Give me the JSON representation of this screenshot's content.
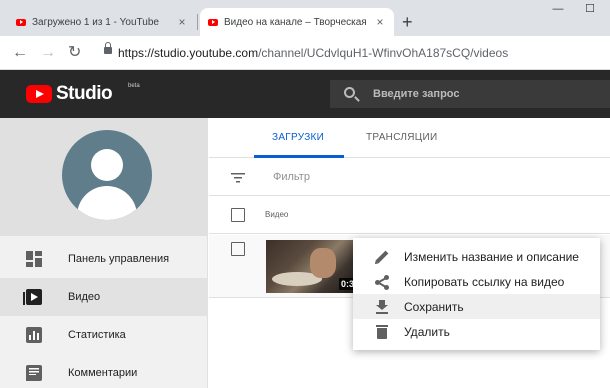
{
  "browser": {
    "tabs": [
      {
        "title": "Загружено 1 из 1 - YouTube",
        "active": false
      },
      {
        "title": "Видео на канале – Творческая с",
        "active": true
      }
    ],
    "new_tab_label": "+",
    "close_label": "×",
    "url_base": "https://studio.youtube.com",
    "url_path": "/channel/UCdvlquH1-WfinvOhA187sCQ/videos",
    "window_controls": {
      "minimize": "—",
      "maximize": "☐"
    }
  },
  "header": {
    "logo_text": "Studio",
    "logo_badge": "beta",
    "search_placeholder": "Введите запрос"
  },
  "sidebar": {
    "items": [
      {
        "label": "Панель управления",
        "icon": "dashboard-icon",
        "active": false
      },
      {
        "label": "Видео",
        "icon": "video-icon",
        "active": true
      },
      {
        "label": "Статистика",
        "icon": "analytics-icon",
        "active": false
      },
      {
        "label": "Комментарии",
        "icon": "comments-icon",
        "active": false
      }
    ]
  },
  "main": {
    "tabs": [
      {
        "label": "ЗАГРУЗКИ",
        "active": true
      },
      {
        "label": "ТРАНСЛЯЦИИ",
        "active": false
      }
    ],
    "filter_placeholder": "Фильтр",
    "column_video": "Видео",
    "video": {
      "duration": "0:3"
    }
  },
  "context_menu": {
    "items": [
      {
        "label": "Изменить название и описание",
        "icon": "edit-icon"
      },
      {
        "label": "Копировать ссылку на видео",
        "icon": "share-icon"
      },
      {
        "label": "Сохранить",
        "icon": "download-icon"
      },
      {
        "label": "Удалить",
        "icon": "delete-icon"
      }
    ]
  },
  "colors": {
    "accent": "#065fd4",
    "youtube_red": "#ff0000",
    "header_bg": "#282828"
  }
}
